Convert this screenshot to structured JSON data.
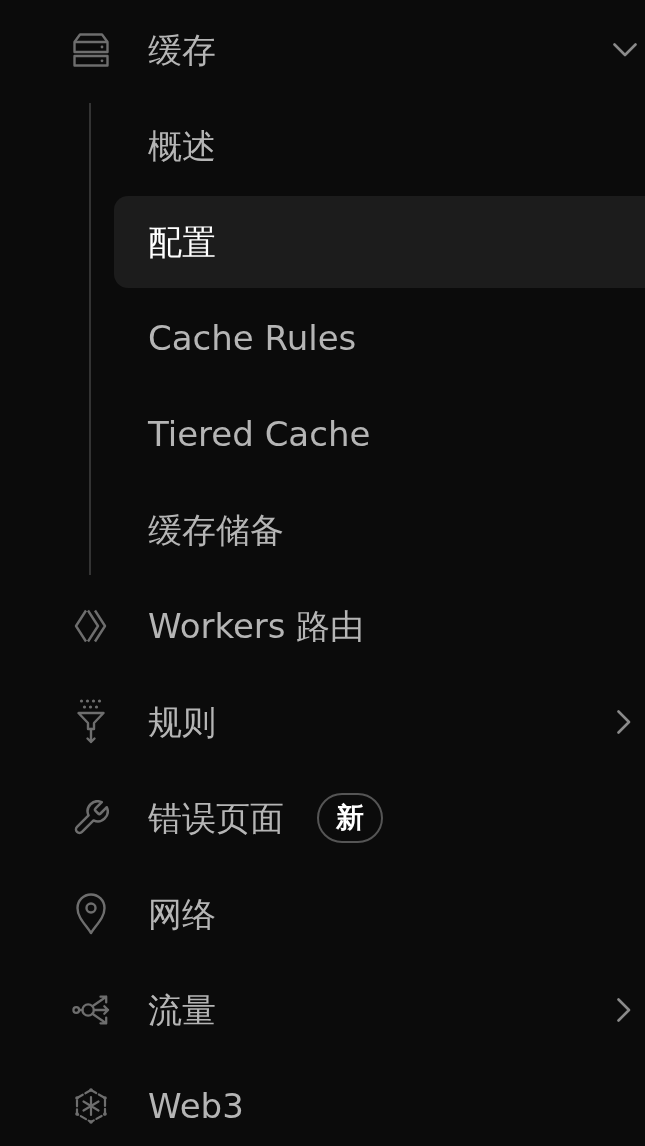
{
  "nav": [
    {
      "kind": "group",
      "label": "缓存",
      "selected": false,
      "expanded": true,
      "children": [
        {
          "label": "概述",
          "selected": false
        },
        {
          "label": "配置",
          "selected": true
        },
        {
          "label": "Cache Rules",
          "selected": false
        },
        {
          "label": "Tiered Cache",
          "selected": false
        },
        {
          "label": "缓存储备",
          "selected": false
        }
      ]
    },
    {
      "kind": "link",
      "label": "Workers 路由",
      "selected": false
    },
    {
      "kind": "group",
      "label": "规则",
      "selected": false,
      "expanded": false
    },
    {
      "kind": "link",
      "label": "错误页面",
      "selected": false,
      "badge": "新"
    },
    {
      "kind": "link",
      "label": "网络",
      "selected": false
    },
    {
      "kind": "group",
      "label": "流量",
      "selected": false,
      "expanded": false
    },
    {
      "kind": "link",
      "label": "Web3",
      "selected": false
    }
  ]
}
